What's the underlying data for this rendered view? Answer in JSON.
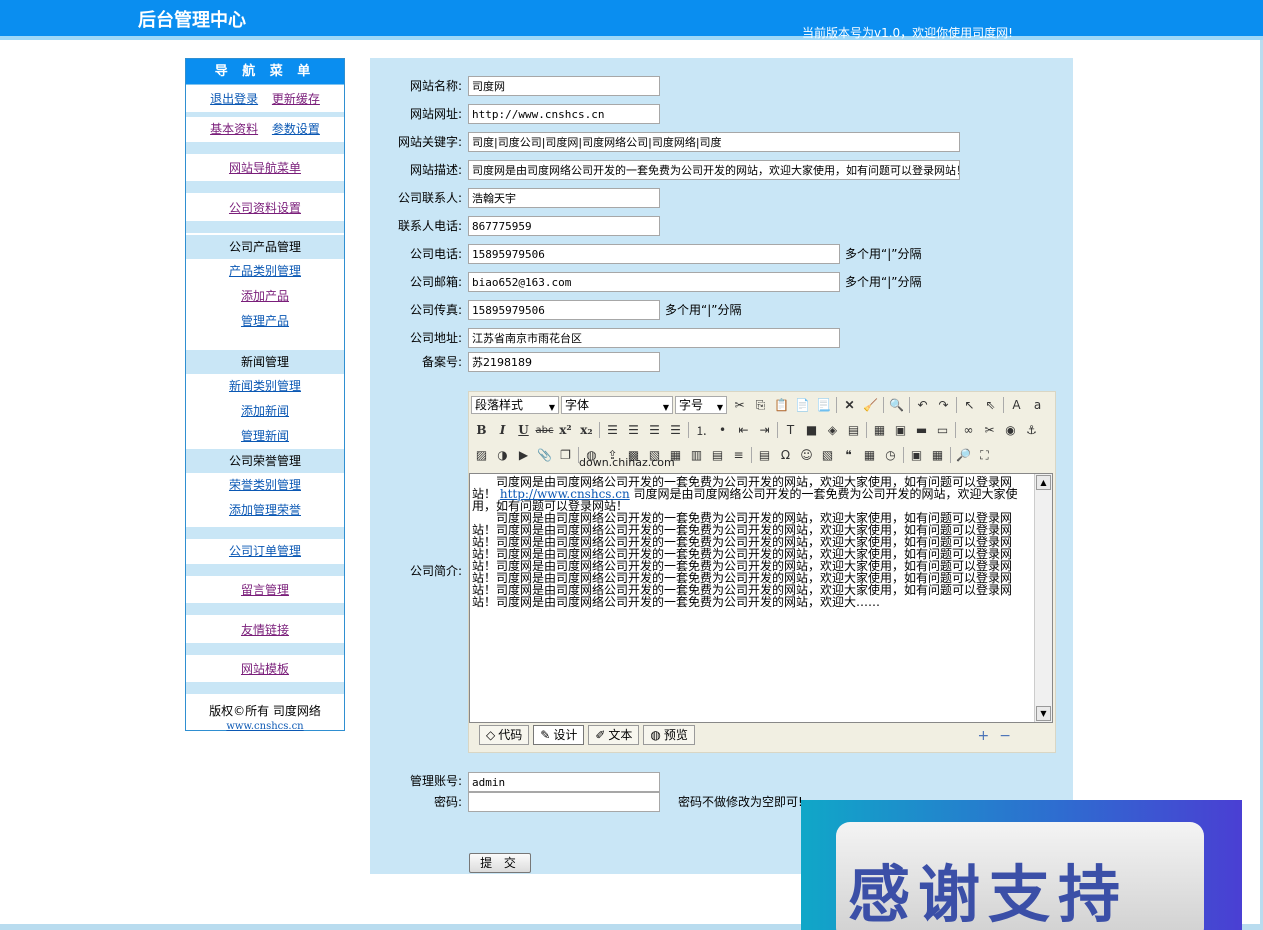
{
  "header": {
    "title": "后台管理中心",
    "version_text": "当前版本号为v1.0，欢迎你使用司度网!"
  },
  "sidebar": {
    "heading": "导 航 菜 单",
    "top_links": [
      {
        "label": "退出登录"
      },
      {
        "label": "更新缓存"
      },
      {
        "label": "基本资料"
      },
      {
        "label": "参数设置"
      }
    ],
    "site_nav": "网站导航菜单",
    "company_info": "公司资料设置",
    "product_group": "公司产品管理",
    "product_links": [
      "产品类别管理",
      "添加产品",
      "管理产品"
    ],
    "news_group": "新闻管理",
    "news_links": [
      "新闻类别管理",
      "添加新闻",
      "管理新闻"
    ],
    "honor_group": "公司荣誉管理",
    "honor_links": [
      "荣誉类别管理",
      "添加管理荣誉"
    ],
    "order": "公司订单管理",
    "message": "留言管理",
    "friend_links": "友情链接",
    "template": "网站模板",
    "copyright": "版权©所有  司度网络",
    "copyright_url": "www.cnshcs.cn"
  },
  "form": {
    "site_name_label": "网站名称:",
    "site_name": "司度网",
    "site_url_label": "网站网址:",
    "site_url": "http://www.cnshcs.cn",
    "keywords_label": "网站关键字:",
    "keywords": "司度|司度公司|司度网|司度网络公司|司度网络|司度",
    "description_label": "网站描述:",
    "description": "司度网是由司度网络公司开发的一套免费为公司开发的网站，欢迎大家使用，如有问题可以登录网站！",
    "contact_label": "公司联系人:",
    "contact": "浩翰天宇",
    "contact_phone_label": "联系人电话:",
    "contact_phone": "867775959",
    "phone_label": "公司电话:",
    "phone": "15895979506",
    "phone_note": "多个用“|”分隔",
    "email_label": "公司邮箱:",
    "email": "biao652@163.com",
    "email_note": "多个用“|”分隔",
    "fax_label": "公司传真:",
    "fax": "15895979506",
    "fax_note": "多个用“|”分隔",
    "address_label": "公司地址:",
    "address": "江苏省南京市雨花台区",
    "icp_label": "备案号:",
    "icp": "苏2198189",
    "intro_label": "公司简介:",
    "admin_label": "管理账号:",
    "admin": "admin",
    "password_label": "密码:",
    "password": "",
    "password_note": "密码不做修改为空即可!",
    "submit_label": "提 交"
  },
  "editor": {
    "style_select": "段落样式",
    "font_select": "字体",
    "size_select": "字号",
    "watermark": "down.chinaz.com",
    "content_line1": "　　司度网是由司度网络公司开发的一套免费为公司开发的网站，欢迎大家使用，如有问题可以登录网站！",
    "content_link": "http://www.cnshcs.cn",
    "content_line2": " 司度网是由司度网络公司开发的一套免费为公司开发的网站，欢迎大家使用，如有问题可以登录网站！",
    "content_body": "　　司度网是由司度网络公司开发的一套免费为公司开发的网站，欢迎大家使用，如有问题可以登录网站！司度网是由司度网络公司开发的一套免费为公司开发的网站，欢迎大家使用，如有问题可以登录网站！司度网是由司度网络公司开发的一套免费为公司开发的网站，欢迎大家使用，如有问题可以登录网站！司度网是由司度网络公司开发的一套免费为公司开发的网站，欢迎大家使用，如有问题可以登录网站！司度网是由司度网络公司开发的一套免费为公司开发的网站，欢迎大家使用，如有问题可以登录网站！司度网是由司度网络公司开发的一套免费为公司开发的网站，欢迎大家使用，如有问题可以登录网站！司度网是由司度网络公司开发的一套免费为公司开发的网站，欢迎大家使用，如有问题可以登录网站！司度网是由司度网络公司开发的一套免费为公司开发的网站，欢迎大……",
    "modes": [
      {
        "label": "代码",
        "icon": "code-icon"
      },
      {
        "label": "设计",
        "icon": "design-icon"
      },
      {
        "label": "文本",
        "icon": "text-icon"
      },
      {
        "label": "预览",
        "icon": "preview-icon"
      }
    ],
    "zoom_in": "+",
    "zoom_out": "−"
  },
  "banner": {
    "text": "感谢支持"
  }
}
